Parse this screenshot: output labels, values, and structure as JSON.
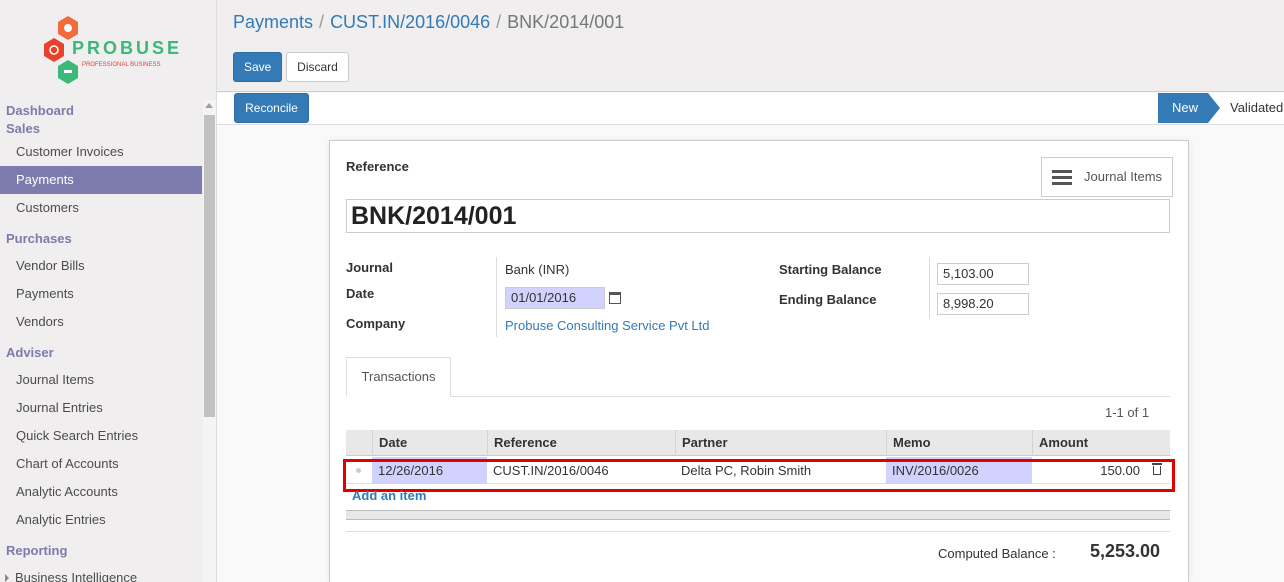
{
  "logo": {
    "brand": "PROBUSE",
    "tagline": "PROFESSIONAL BUSINESS"
  },
  "sidebar": {
    "top_links": [
      "Dashboard",
      "Sales"
    ],
    "sales_items": [
      "Customer Invoices",
      "Payments",
      "Customers"
    ],
    "purchases_title": "Purchases",
    "purchases_items": [
      "Vendor Bills",
      "Payments",
      "Vendors"
    ],
    "adviser_title": "Adviser",
    "adviser_items": [
      "Journal Items",
      "Journal Entries",
      "Quick Search Entries",
      "Chart of Accounts",
      "Analytic Accounts",
      "Analytic Entries"
    ],
    "reporting_title": "Reporting",
    "reporting_items": [
      "Business Intelligence"
    ]
  },
  "breadcrumb": [
    "Payments",
    "CUST.IN/2016/0046",
    "BNK/2014/001"
  ],
  "buttons": {
    "save": "Save",
    "discard": "Discard",
    "reconcile": "Reconcile"
  },
  "status": {
    "current": "New",
    "next": "Validated"
  },
  "form": {
    "reference_label": "Reference",
    "reference": "BNK/2014/001",
    "journal_items_button": "Journal Items",
    "journal_label": "Journal",
    "journal": "Bank (INR)",
    "date_label": "Date",
    "date": "01/01/2016",
    "company_label": "Company",
    "company": "Probuse Consulting Service Pvt Ltd",
    "starting_balance_label": "Starting Balance",
    "starting_balance": "5,103.00",
    "ending_balance_label": "Ending Balance",
    "ending_balance": "8,998.20"
  },
  "tabs": [
    "Transactions"
  ],
  "pager": "1-1 of 1",
  "table": {
    "headers": [
      "Date",
      "Reference",
      "Partner",
      "Memo",
      "Amount"
    ],
    "rows": [
      {
        "date": "12/26/2016",
        "reference": "CUST.IN/2016/0046",
        "partner": "Delta PC, Robin Smith",
        "memo": "INV/2016/0026",
        "amount": "150.00"
      }
    ],
    "add_item": "Add an item"
  },
  "computed_balance_label": "Computed Balance :",
  "computed_balance": "5,253.00",
  "colors": {
    "accent": "#337ab7",
    "sidebar_active": "#7c7bad",
    "highlight": "#d2d2ff",
    "annotation": "#e00000"
  }
}
